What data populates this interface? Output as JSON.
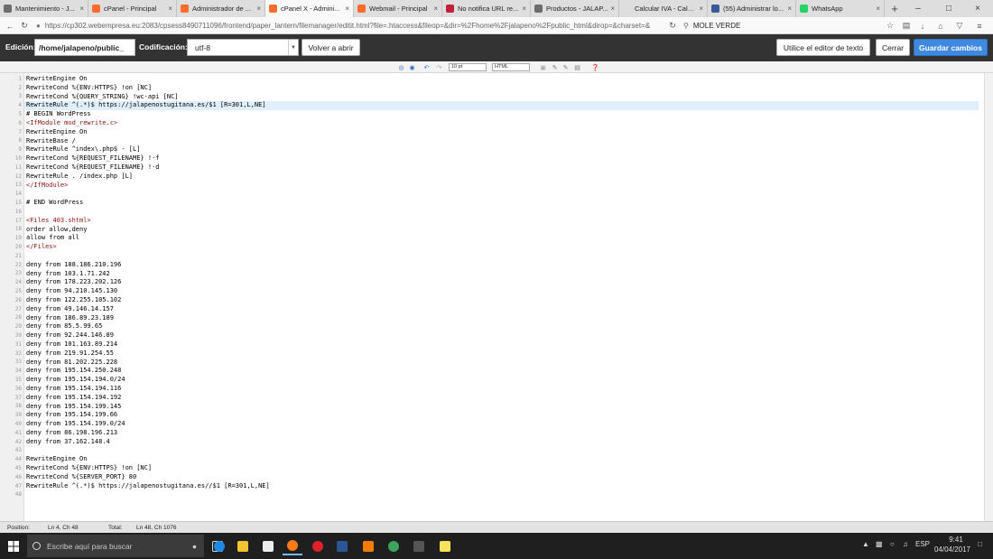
{
  "tabs": [
    {
      "title": "Mantenimiento - J...",
      "fav": "joomla",
      "color": "#6d6d6d"
    },
    {
      "title": "cPanel - Principal",
      "fav": "cpanel",
      "color": "#ff6c2c"
    },
    {
      "title": "Administrador de ...",
      "fav": "cpanel",
      "color": "#ff6c2c"
    },
    {
      "title": "cPanel X - Admini...",
      "fav": "cpanel",
      "color": "#ff6c2c",
      "active": true
    },
    {
      "title": "Webmail - Principal",
      "fav": "cpanel",
      "color": "#ff6c2c"
    },
    {
      "title": "No notifica URL re...",
      "fav": "wu",
      "color": "#c0203a"
    },
    {
      "title": "Productos - JALAP...",
      "fav": "joomla",
      "color": "#6d6d6d"
    },
    {
      "title": "Calcular IVA - Calcula..."
    },
    {
      "title": "(55) Administrar lo...",
      "fav": "facebook",
      "color": "#3b5998"
    },
    {
      "title": "WhatsApp",
      "fav": "whatsapp",
      "color": "#25d366"
    }
  ],
  "address": {
    "url": "https://cp302.webempresa.eu:2083/cpsess8490711096/frontend/paper_lantern/filemanager/editit.html?file=.htaccess&fileop=&dir=%2Fhome%2Fjalapeno%2Fpublic_html&dirop=&charset=&",
    "search_value": "MOLE VERDE"
  },
  "editorbar": {
    "edition_label": "Edición:",
    "path_value": "/home/jalapeno/public_",
    "encoding_label": "Codificación:",
    "encoding_value": "utf-8",
    "reopen_button": "Volver a abrir",
    "use_editor_button": "Utilice el editor de texto",
    "close_button": "Cerrar",
    "save_button": "Guardar cambios"
  },
  "code_toolbar": {
    "font_size": "10 pt",
    "syntax": "HTML"
  },
  "code_lines": [
    "RewriteEngine On",
    "RewriteCond %{ENV:HTTPS} !on [NC]",
    "RewriteCond %{QUERY_STRING} !wc-api [NC]",
    "RewriteRule ^(.*)$ https://jalapenostugitana.es/$1 [R=301,L,NE]",
    "# BEGIN WordPress",
    "<IfModule mod_rewrite.c>",
    "RewriteEngine On",
    "RewriteBase /",
    "RewriteRule ^index\\.php$ - [L]",
    "RewriteCond %{REQUEST_FILENAME} !-f",
    "RewriteCond %{REQUEST_FILENAME} !-d",
    "RewriteRule . /index.php [L]",
    "</IfModule>",
    "",
    "# END WordPress",
    "",
    "<Files 403.shtml>",
    "order allow,deny",
    "allow from all",
    "</Files>",
    "",
    "deny from 188.186.210.196",
    "deny from 103.1.71.242",
    "deny from 178.223.202.126",
    "deny from 94.210.145.130",
    "deny from 122.255.105.102",
    "deny from 49.146.14.157",
    "deny from 186.89.23.189",
    "deny from 85.5.99.65",
    "deny from 92.244.146.89",
    "deny from 101.163.89.214",
    "deny from 219.91.254.55",
    "deny from 81.202.225.228",
    "deny from 195.154.250.248",
    "deny from 195.154.194.0/24",
    "deny from 195.154.194.116",
    "deny from 195.154.194.192",
    "deny from 195.154.199.145",
    "deny from 195.154.199.66",
    "deny from 195.154.199.0/24",
    "deny from 86.198.196.213",
    "deny from 37.162.148.4",
    "",
    "RewriteEngine On",
    "RewriteCond %{ENV:HTTPS} !on [NC]",
    "RewriteCond %{SERVER_PORT} 80",
    "RewriteRule ^(.*)$ https://jalapenostugitana.es//$1 [R=301,L,NE]",
    ""
  ],
  "highlighted_line": 4,
  "statusbar": {
    "position_label": "Position:",
    "position_value": "Ln 4, Ch 48",
    "total_label": "Total:",
    "total_value": "Ln 48, Ch 1076"
  },
  "taskbar": {
    "search_placeholder": "Escribe aquí para buscar",
    "lang": "ESP",
    "time": "9:41",
    "date": "04/04/2017"
  }
}
